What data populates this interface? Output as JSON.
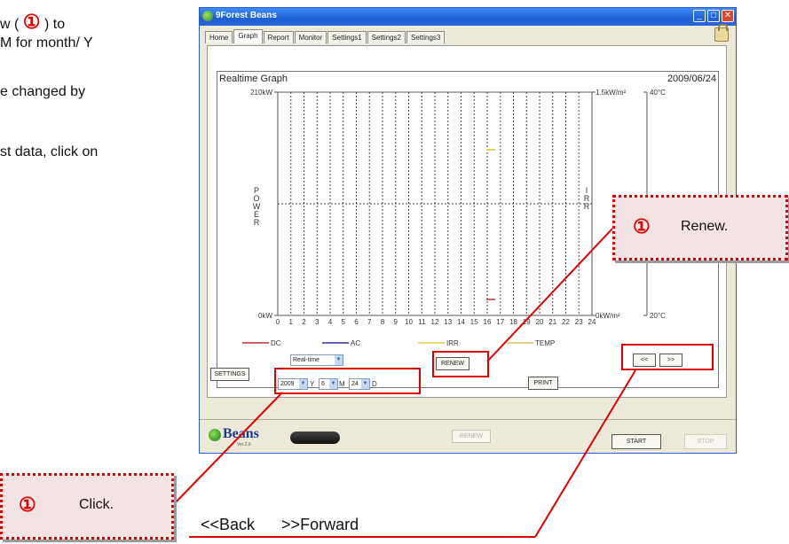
{
  "doc_text": {
    "line1_a": "w (",
    "line1_circ": "①",
    "line1_b": ") to",
    "line2": "M for month/ Y",
    "line3": "e  changed  by",
    "line4": "st data, click on"
  },
  "window": {
    "title": "9Forest Beans",
    "tabs": [
      "Home",
      "Graph",
      "Report",
      "Monitor",
      "Settings1",
      "Settings2",
      "Settings3"
    ],
    "active_tab": "Graph"
  },
  "graph": {
    "title": "Realtime Graph",
    "date": "2009/06/24",
    "left_max": "210kW",
    "left_min": "0kW",
    "right_max": "1.5kW/m²",
    "right_min": "0kW/m²",
    "temp_max": "40°C",
    "temp_min": "20°C",
    "left_axis_label": "POWER",
    "right_axis_label": "IRR",
    "hours": [
      "0",
      "1",
      "2",
      "3",
      "4",
      "5",
      "6",
      "7",
      "8",
      "9",
      "10",
      "11",
      "12",
      "13",
      "14",
      "15",
      "16",
      "17",
      "18",
      "19",
      "20",
      "21",
      "22",
      "23",
      "24"
    ],
    "legend": [
      {
        "name": "DC",
        "color": "#c03030"
      },
      {
        "name": "AC",
        "color": "#303090"
      },
      {
        "name": "IRR",
        "color": "#e0d040"
      },
      {
        "name": "TEMP",
        "color": "#e0c070"
      }
    ]
  },
  "controls": {
    "mode": "Real-time",
    "settings_label": "SETTINGS",
    "year": "2009",
    "year_unit": "Y",
    "month": "6",
    "month_unit": "M",
    "day": "24",
    "day_unit": "D",
    "renew_label": "RENEW",
    "print_label": "PRINT",
    "back_label": "<<",
    "forward_label": ">>"
  },
  "statusbar": {
    "logo": "Beans",
    "version": "Ver.2.0",
    "renew_label": "RENEW",
    "start_label": "START",
    "stop_label": "STOP"
  },
  "annotations": {
    "renew_circ": "①",
    "renew_text": "Renew.",
    "click_circ": "①",
    "click_text": "Click.",
    "back_forward": "<<Back      >>Forward"
  },
  "colors": {
    "accent_red": "#e00000",
    "title_blue": "#1c5fd6"
  }
}
